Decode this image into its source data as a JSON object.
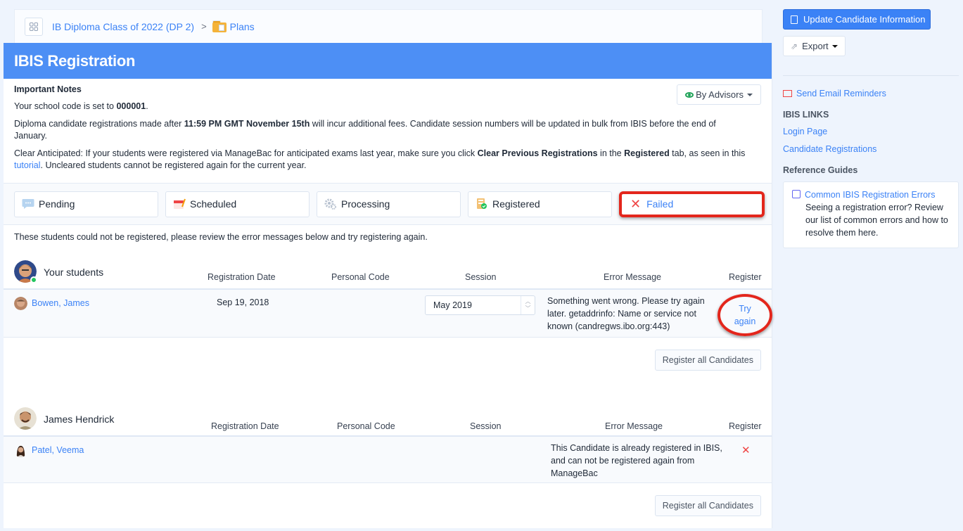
{
  "breadcrumb": {
    "items": [
      "IB Diploma Class of 2022 (DP 2)",
      "Plans"
    ],
    "separator": ">"
  },
  "page": {
    "title": "IBIS Registration"
  },
  "notes": {
    "heading": "Important Notes",
    "school_code_prefix": "Your school code is set to ",
    "school_code": "000001",
    "school_code_suffix": ".",
    "deadline_prefix": "Diploma candidate registrations made after ",
    "deadline": "11:59 PM GMT November 15th",
    "deadline_suffix": " will incur additional fees. Candidate session numbers will be updated in bulk from IBIS before the end of January.",
    "clear_prefix": "Clear Anticipated: If your students were registered via ManageBac for anticipated exams last year, make sure you click ",
    "clear_bold": "Clear Previous Registrations",
    "clear_mid": " in the ",
    "clear_tab": "Registered",
    "clear_suffix": " tab, as seen in this ",
    "tutorial_link": "tutorial",
    "clear_end": ". Uncleared students cannot be registered again for the current year.",
    "filter_button": "By Advisors"
  },
  "tabs": [
    {
      "label": "Pending",
      "icon": "chat-bubble-icon",
      "active": false
    },
    {
      "label": "Scheduled",
      "icon": "calendar-icon",
      "active": false
    },
    {
      "label": "Processing",
      "icon": "gears-icon",
      "active": false
    },
    {
      "label": "Registered",
      "icon": "registered-doc-icon",
      "active": false
    },
    {
      "label": "Failed",
      "icon": "x-icon",
      "active": true
    }
  ],
  "info_text": "These students could not be registered, please review the error messages below and try registering again.",
  "columns": {
    "registration_date": "Registration Date",
    "personal_code": "Personal Code",
    "session": "Session",
    "error_message": "Error Message",
    "register": "Register"
  },
  "groups": [
    {
      "advisor": "Your students",
      "online": true,
      "rows": [
        {
          "student": "Bowen, James",
          "registration_date": "Sep 19, 2018",
          "personal_code": "",
          "session": "May 2019",
          "error": "Something went wrong. Please try again later. getaddrinfo: Name or service not known (candregws.ibo.org:443)",
          "register_action": "Try again"
        }
      ],
      "register_all": "Register all Candidates"
    },
    {
      "advisor": "James Hendrick",
      "online": false,
      "rows": [
        {
          "student": "Patel, Veema",
          "registration_date": "",
          "personal_code": "",
          "session": "",
          "error": "This Candidate is already registered in IBIS, and can not be registered again from ManageBac",
          "register_action": "✕"
        }
      ],
      "register_all": "Register all Candidates"
    }
  ],
  "sidebar": {
    "update_button": "Update Candidate Information",
    "export_button": "Export",
    "email_reminders": "Send Email Reminders",
    "ibis_links_heading": "IBIS LINKS",
    "links": [
      "Login Page",
      "Candidate Registrations"
    ],
    "reference_heading": "Reference Guides",
    "guide_title": "Common IBIS Registration Errors",
    "guide_text": "Seeing a registration error? Review our list of common errors and how to resolve them here."
  },
  "colors": {
    "brand_blue": "#4d8ff5",
    "link_blue": "#3b82f6",
    "error_red": "#ef4444",
    "highlight_red": "#e3261c",
    "online_green": "#22c55e"
  }
}
